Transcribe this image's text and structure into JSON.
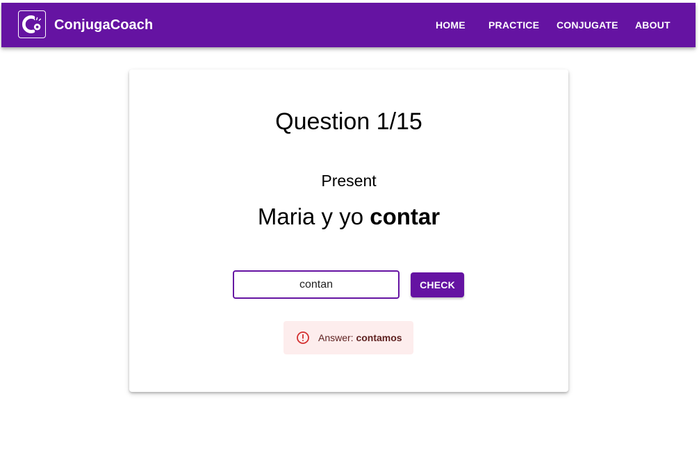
{
  "app": {
    "brand_name": "ConjugaCoach",
    "brand_color": "#6513a2",
    "logo_icon": "conjugacoach-logo"
  },
  "nav": {
    "items": [
      {
        "label": "HOME"
      },
      {
        "label": "PRACTICE"
      },
      {
        "label": "CONJUGATE"
      },
      {
        "label": "ABOUT"
      }
    ]
  },
  "quiz": {
    "question_title": "Question 1/15",
    "tense": "Present",
    "subject": "Maria y yo",
    "verb": "contar",
    "answer_value": "contan",
    "answer_placeholder": "",
    "check_label": "CHECK"
  },
  "feedback": {
    "icon": "error-outline-icon",
    "label": "Answer:",
    "correct_answer": "contamos",
    "bg_color": "#fdeded",
    "icon_color": "#d32f2f"
  }
}
